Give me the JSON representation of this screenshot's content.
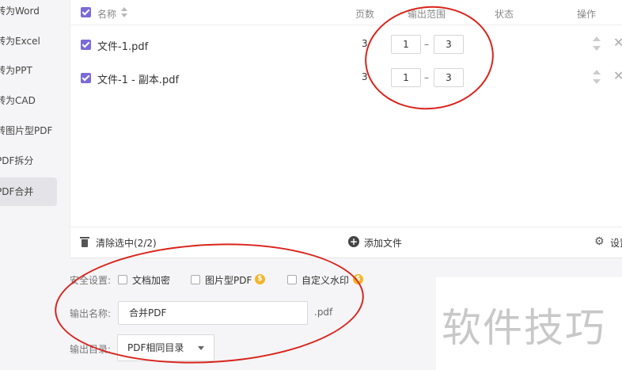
{
  "sidebar": {
    "items": [
      {
        "label": "转为Word"
      },
      {
        "label": "转为Excel"
      },
      {
        "label": "转为PPT"
      },
      {
        "label": "转为CAD"
      },
      {
        "label": "转图片型PDF"
      },
      {
        "label": "PDF拆分"
      },
      {
        "label": "PDF合并",
        "active": true
      }
    ]
  },
  "table": {
    "headers": {
      "name": "名称",
      "pages": "页数",
      "range": "输出范围",
      "status": "状态",
      "action": "操作"
    },
    "rows": [
      {
        "name": "文件-1.pdf",
        "pages": "3",
        "range_from": "1",
        "range_to": "3",
        "checked": true
      },
      {
        "name": "文件-1 - 副本.pdf",
        "pages": "3",
        "range_from": "1",
        "range_to": "3",
        "checked": true
      }
    ],
    "range_separator": "–",
    "delete_glyph": "✕"
  },
  "footer": {
    "clear_label": "清除选中(2/2)",
    "add_label": "添加文件",
    "settings_label": "设置"
  },
  "settings": {
    "security_label": "安全设置:",
    "options": [
      {
        "label": "文档加密",
        "vip": false
      },
      {
        "label": "图片型PDF",
        "vip": true
      },
      {
        "label": "自定义水印",
        "vip": true
      }
    ],
    "vip_glyph": "$",
    "output_name_label": "输出名称:",
    "output_name_value": "合并PDF",
    "output_ext": ".pdf",
    "output_dir_label": "输出目录:",
    "output_dir_value": "PDF相同目录"
  },
  "watermark": {
    "text": "软件技巧"
  },
  "colors": {
    "accent": "#7a6ad8",
    "annotation": "#d9241c",
    "vip": "#f3b52c"
  }
}
